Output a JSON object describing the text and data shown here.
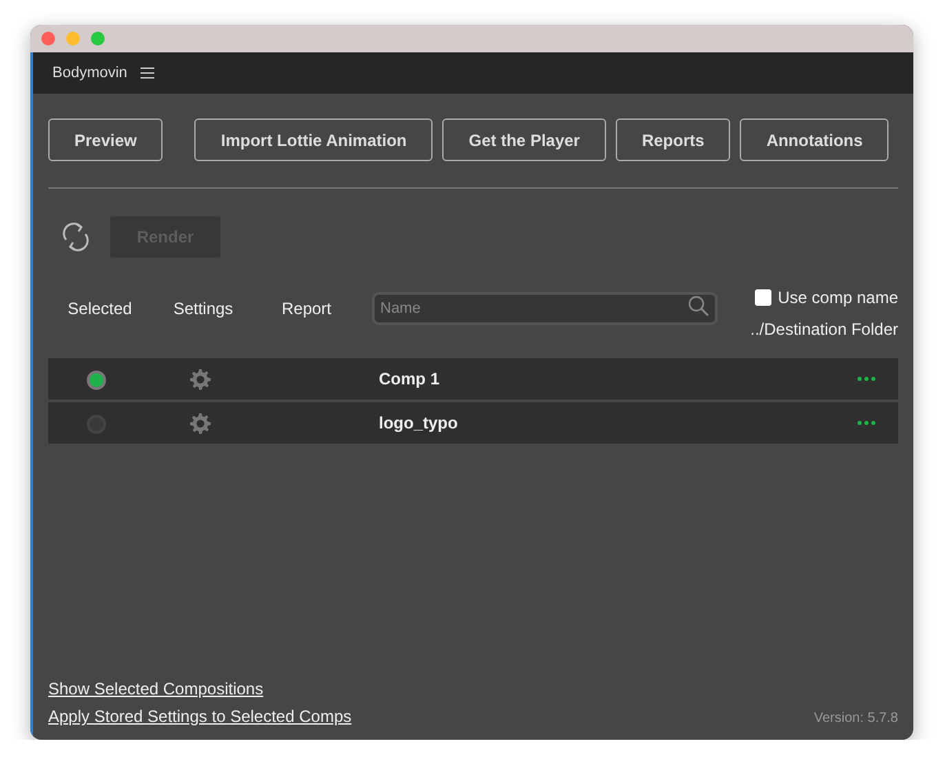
{
  "panel": {
    "title": "Bodymovin"
  },
  "toolbar_buttons": [
    "Preview",
    "Import Lottie Animation",
    "Get the Player",
    "Reports",
    "Annotations"
  ],
  "render_button": {
    "label": "Render",
    "disabled": true
  },
  "columns": [
    "Selected",
    "Settings",
    "Report"
  ],
  "search": {
    "placeholder": "Name"
  },
  "use_comp_name": {
    "label": "Use comp name",
    "checked": false
  },
  "destination_header": "../Destination Folder",
  "comps": [
    {
      "name": "Comp 1",
      "selected": true
    },
    {
      "name": "logo_typo",
      "selected": false
    }
  ],
  "links": [
    "Show Selected Compositions",
    "Apply Stored Settings to Selected Comps"
  ],
  "version": "Version: 5.7.8"
}
